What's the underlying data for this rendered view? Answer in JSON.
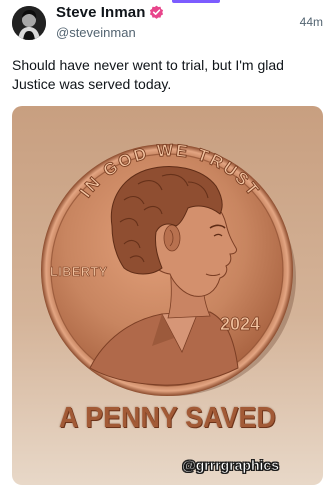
{
  "header": {
    "display_name": "Steve Inman",
    "handle": "@steveinman",
    "time": "44m",
    "verified_icon": "verified-badge-icon",
    "verified_color": "#e8458b"
  },
  "post": {
    "text": "Should have never went to trial, but I'm glad Justice was served today."
  },
  "media": {
    "coin_top_text": "IN GOD WE TRUST",
    "coin_left_text": "LIBERTY",
    "coin_year": "2024",
    "caption": "A PENNY SAVED",
    "watermark": "@grrrgraphics",
    "coin_color": "#c47a52",
    "caption_color": "#a25a36"
  }
}
